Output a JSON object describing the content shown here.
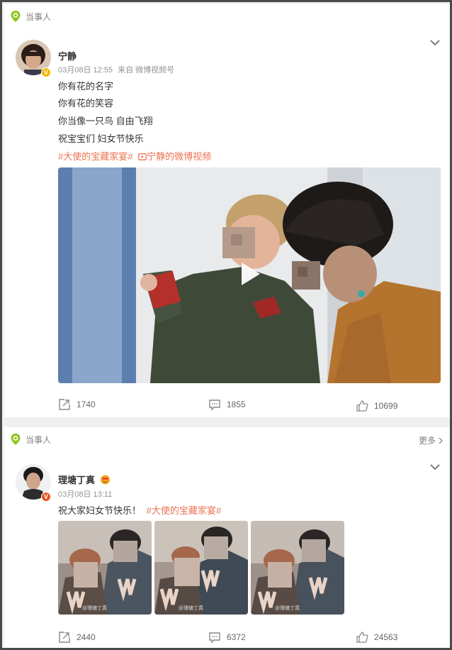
{
  "posts": [
    {
      "party_label": "当事人",
      "username": "宁静",
      "time": "03月08日 12:55",
      "source": "来自 微博视频号",
      "lines": [
        "你有花的名字",
        "你有花的笑容",
        "你当像一只鸟 自由飞翔",
        "祝宝宝们 妇女节快乐"
      ],
      "topic": "#大使的宝藏家宴#",
      "video_link": "宁静的微博视频",
      "share": "1740",
      "comments": "1855",
      "likes": "10699"
    },
    {
      "party_label": "当事人",
      "more_label": "更多",
      "username": "理塘丁真",
      "time": "03月08日 13:11",
      "text": "祝大家妇女节快乐！",
      "topic": "#大使的宝藏家宴#",
      "watermark": "@理塘丁真",
      "share": "2440",
      "comments": "6372",
      "likes": "24563"
    }
  ]
}
